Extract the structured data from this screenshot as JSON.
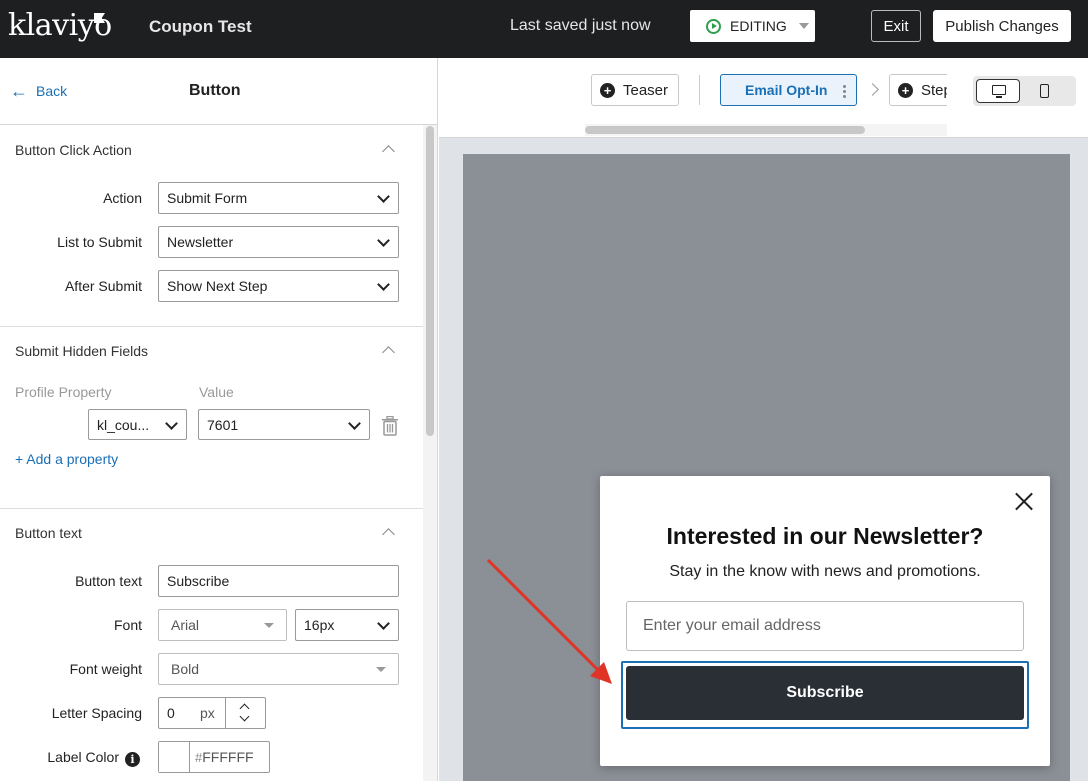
{
  "topbar": {
    "logo": "klaviyo",
    "form_name": "Coupon Test",
    "save_status": "Last saved just now",
    "mode": "EDITING",
    "exit_label": "Exit",
    "publish_label": "Publish Changes"
  },
  "panel": {
    "back_label": "Back",
    "title": "Button",
    "click_action": {
      "title": "Button Click Action",
      "action_label": "Action",
      "action_value": "Submit Form",
      "list_label": "List to Submit",
      "list_value": "Newsletter",
      "after_label": "After Submit",
      "after_value": "Show Next Step"
    },
    "hidden_fields": {
      "title": "Submit Hidden Fields",
      "profile_property_header": "Profile Property",
      "value_header": "Value",
      "property_value": "kl_cou...",
      "value_value": "7601",
      "add_label": "+ Add a property"
    },
    "button_text": {
      "title": "Button text",
      "text_label": "Button text",
      "text_value": "Subscribe",
      "font_label": "Font",
      "font_value": "Arial",
      "font_size_value": "16px",
      "weight_label": "Font weight",
      "weight_value": "Bold",
      "spacing_label": "Letter Spacing",
      "spacing_value": "0",
      "spacing_unit": "px",
      "color_label": "Label Color",
      "color_hash": "#",
      "color_value": "FFFFFF"
    }
  },
  "steps": {
    "teaser": "Teaser",
    "active": "Email Opt-In",
    "next": "Step"
  },
  "popup": {
    "title": "Interested in our Newsletter?",
    "subtitle": "Stay in the know with news and promotions.",
    "email_placeholder": "Enter your email address",
    "submit_label": "Subscribe"
  },
  "colors": {
    "topbar": "#1e1f21",
    "link": "#1a6fb5",
    "overlay": "#8b8f96",
    "button": "#2a2f36",
    "annotation_arrow": "#e03426"
  }
}
